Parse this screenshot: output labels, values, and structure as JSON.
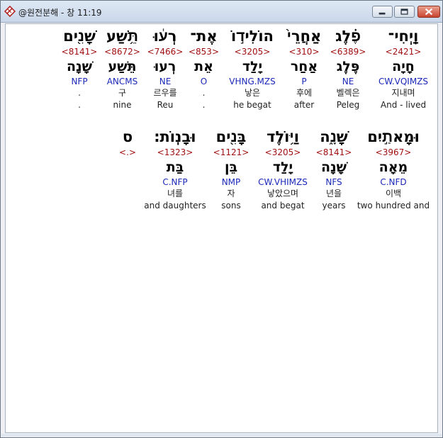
{
  "window": {
    "title": "@원전분해 - 창 11:19",
    "controls": {
      "minimize": "minimize",
      "maximize": "maximize",
      "close": "close"
    }
  },
  "row1": [
    {
      "heb": "וַֽיְחִי־",
      "strong": "<2421>",
      "lemma": "חָיָה",
      "morph": "CW.VQIMZS",
      "kor": "지내며",
      "eng": "And - lived"
    },
    {
      "heb": "פֶ֗לֶג",
      "strong": "<6389>",
      "lemma": "פֶּלֶג",
      "morph": "NE",
      "kor": "벨렉은",
      "eng": "Peleg"
    },
    {
      "heb": "אַחֲרֵי֙",
      "strong": "<310>",
      "lemma": "אַחַר",
      "morph": "P",
      "kor": "후에",
      "eng": "after"
    },
    {
      "heb": "הוֹלִיד֣וֹ",
      "strong": "<3205>",
      "lemma": "יָלַד",
      "morph": "VHNG.MZS",
      "kor": "낳은",
      "eng": "he begat"
    },
    {
      "heb": "אֶת־",
      "strong": "<853>",
      "lemma": "אֵת",
      "morph": "O",
      "kor": ".",
      "eng": "."
    },
    {
      "heb": "רְע֔וּ",
      "strong": "<7466>",
      "lemma": "רְעוּ",
      "morph": "NE",
      "kor": "르우를",
      "eng": "Reu"
    },
    {
      "heb": "תֵּ֥שַׁע",
      "strong": "<8672>",
      "lemma": "תֵּשַׁע",
      "morph": "ANCMS",
      "kor": "구",
      "eng": "nine"
    },
    {
      "heb": "שָׁנִ֖ים",
      "strong": "<8141>",
      "lemma": "שָׁנָה",
      "morph": "NFP",
      "kor": ".",
      "eng": "."
    }
  ],
  "row2": [
    {
      "heb": "וּמָאתַ֣יִם",
      "strong": "<3967>",
      "lemma": "מֵאָה",
      "morph": "C.NFD",
      "kor": "이백",
      "eng": "two hundred and"
    },
    {
      "heb": "שָׁנָ֑ה",
      "strong": "<8141>",
      "lemma": "שָׁנָה",
      "morph": "NFS",
      "kor": "년을",
      "eng": "years"
    },
    {
      "heb": "וַיּ֥וֹלֶד",
      "strong": "<3205>",
      "lemma": "יָלַד",
      "morph": "CW.VHIMZS",
      "kor": "낳았으며",
      "eng": "and begat"
    },
    {
      "heb": "בָּנִ֖ים",
      "strong": "<1121>",
      "lemma": "בֵּן",
      "morph": "NMP",
      "kor": "자",
      "eng": "sons"
    },
    {
      "heb": "וּבָנֽוֹת׃",
      "strong": "<1323>",
      "lemma": "בַּת",
      "morph": "C.NFP",
      "kor": "녀를",
      "eng": "and daughters"
    },
    {
      "heb": "ס",
      "strong": "<.>",
      "lemma": "",
      "morph": "",
      "kor": "",
      "eng": ""
    }
  ],
  "colors": {
    "strong": "#a01010",
    "morph": "#1a28b8",
    "titlebar": "#c9d7ea",
    "close": "#c9452f"
  }
}
